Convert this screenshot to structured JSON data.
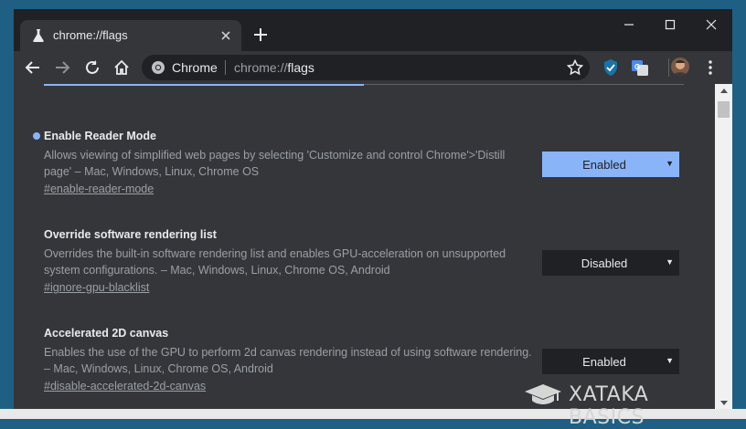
{
  "tab": {
    "title": "chrome://flags"
  },
  "omnibox": {
    "chip": "Chrome",
    "url_prefix": "chrome://",
    "url_highlight": "flags"
  },
  "flags": [
    {
      "title": "Enable Reader Mode",
      "description": "Allows viewing of simplified web pages by selecting 'Customize and control Chrome'>'Distill page' – Mac, Windows, Linux, Chrome OS",
      "link": "#enable-reader-mode",
      "value": "Enabled",
      "modified": true
    },
    {
      "title": "Override software rendering list",
      "description": "Overrides the built-in software rendering list and enables GPU-acceleration on unsupported system configurations. – Mac, Windows, Linux, Chrome OS, Android",
      "link": "#ignore-gpu-blacklist",
      "value": "Disabled",
      "modified": false
    },
    {
      "title": "Accelerated 2D canvas",
      "description": "Enables the use of the GPU to perform 2d canvas rendering instead of using software rendering. – Mac, Windows, Linux, Chrome OS, Android",
      "link": "#disable-accelerated-2d-canvas",
      "value": "Enabled",
      "modified": false
    }
  ],
  "watermark": "XATAKA BASICS",
  "colors": {
    "accent": "#8ab4f8",
    "content_bg": "#35363a",
    "frame_bg": "#202124"
  }
}
